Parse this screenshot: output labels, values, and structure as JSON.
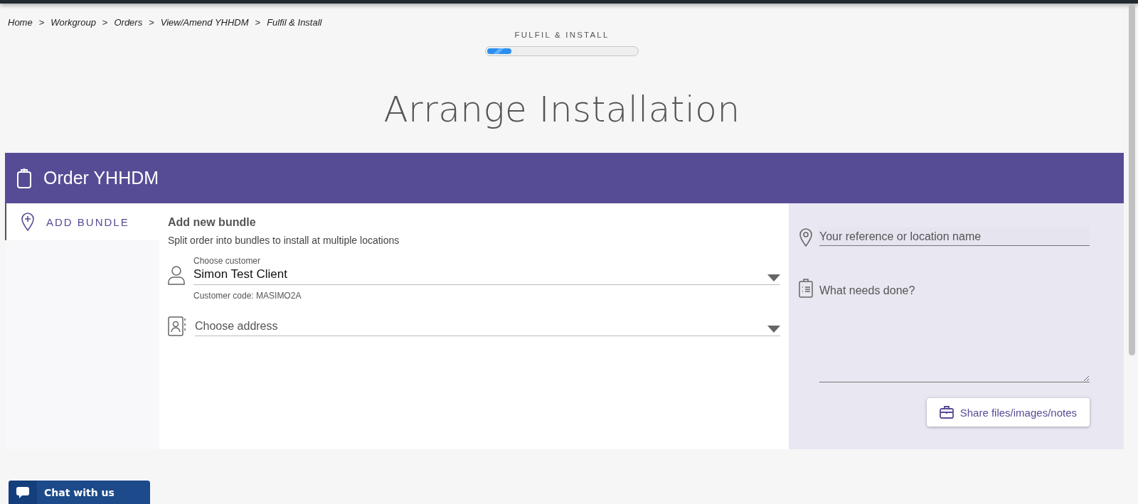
{
  "breadcrumb": {
    "separator": ">",
    "items": [
      "Home",
      "Workgroup",
      "Orders",
      "View/Amend YHHDM",
      "Fulfil & Install"
    ]
  },
  "progress": {
    "label": "FULFIL & INSTALL",
    "level": 0.16
  },
  "page_title": "Arrange Installation",
  "order": {
    "title": "Order YHHDM",
    "sidebar": {
      "items": [
        {
          "label": "ADD BUNDLE",
          "selected": true
        }
      ]
    },
    "bundle": {
      "heading": "Add new bundle",
      "description": "Split order into bundles to install at multiple locations",
      "customer": {
        "label": "Choose customer",
        "value": "Simon Test Client",
        "helper": "Customer code: MASIMO2A"
      },
      "address": {
        "placeholder": "Choose address"
      }
    },
    "details": {
      "reference": {
        "placeholder": "Your reference or location name"
      },
      "work": {
        "placeholder": "What needs done?"
      },
      "share_button": "Share files/images/notes"
    }
  },
  "chat": {
    "label": "Chat with us"
  }
}
